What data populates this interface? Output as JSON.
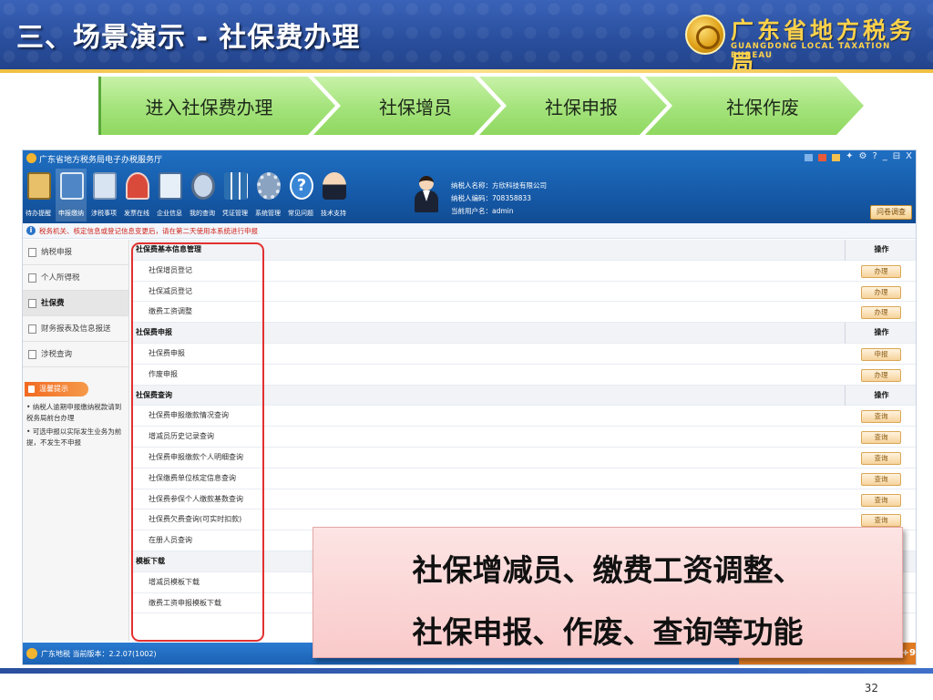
{
  "slide": {
    "title": "三、场景演示 - 社保费办理",
    "bureau_name_cn": "广东省地方税务局",
    "bureau_name_en": "GUANGDONG LOCAL TAXATION BUREAU",
    "page_number": "32"
  },
  "process_steps": [
    "进入社保费办理",
    "社保增员",
    "社保申报",
    "社保作废"
  ],
  "portal": {
    "window_title": "广东省地方税务局电子办税服务厅",
    "window_controls": [
      "?",
      "_",
      "⊟",
      "X"
    ],
    "toolbar": [
      {
        "label": "待办提醒",
        "icon": "clipboard-icon",
        "color": "#e8c06a"
      },
      {
        "label": "申报缴纳",
        "icon": "monitor-icon",
        "color": "#4f86c6"
      },
      {
        "label": "涉税事项",
        "icon": "document-icon",
        "color": "#d9e4f2"
      },
      {
        "label": "发票在线",
        "icon": "stamp-icon",
        "color": "#d94a3a"
      },
      {
        "label": "企业信息",
        "icon": "building-icon",
        "color": "#e6eef8"
      },
      {
        "label": "我的查询",
        "icon": "magnifier-icon",
        "color": "#c8d6ea"
      },
      {
        "label": "凭证管理",
        "icon": "binders-icon",
        "color": "#2c6fb0"
      },
      {
        "label": "系统管理",
        "icon": "gear-icon",
        "color": "#8aa3c0"
      },
      {
        "label": "常见问题",
        "icon": "question-icon",
        "color": "#3a86d6"
      },
      {
        "label": "技术支持",
        "icon": "support-agent-icon",
        "color": "#1b2233"
      }
    ],
    "user": {
      "taxpayer_name": "纳税人名称：方欣科技有限公司",
      "taxpayer_code": "纳税人编码：708358833",
      "current_user": "当前用户名：admin"
    },
    "survey_button": "问卷调查",
    "notice": "税务机关、核定信息或登记信息变更后，请在第二天使用本系统进行申报",
    "sidebar": {
      "items": [
        "纳税申报",
        "个人所得税",
        "社保费",
        "财务报表及信息报送",
        "涉税查询"
      ],
      "tips_title": "温馨提示",
      "tips": [
        "• 纳税人逾期申报缴纳税款请到税务局前台办理",
        "• 可选申报以实际发生业务为前提，不发生不申报"
      ]
    },
    "sections": [
      {
        "title": "社保费基本信息管理",
        "op_header": "操作",
        "items": [
          {
            "label": "社保增员登记",
            "action": "办理"
          },
          {
            "label": "社保减员登记",
            "action": "办理"
          },
          {
            "label": "缴费工资调整",
            "action": "办理"
          }
        ]
      },
      {
        "title": "社保费申报",
        "op_header": "操作",
        "items": [
          {
            "label": "社保费申报",
            "action": "申报"
          },
          {
            "label": "作废申报",
            "action": "办理"
          }
        ]
      },
      {
        "title": "社保费查询",
        "op_header": "操作",
        "items": [
          {
            "label": "社保费申报缴款情况查询",
            "action": "查询"
          },
          {
            "label": "增减员历史记录查询",
            "action": "查询"
          },
          {
            "label": "社保费申报缴款个人明细查询",
            "action": "查询"
          },
          {
            "label": "社保缴费单位核定信息查询",
            "action": "查询"
          },
          {
            "label": "社保费参保个人缴款基数查询",
            "action": "查询"
          },
          {
            "label": "社保费欠费查询(可实时扣款)",
            "action": "查询"
          },
          {
            "label": "在册人员查询",
            "action": ""
          }
        ]
      },
      {
        "title": "模板下载",
        "op_header": "",
        "items": [
          {
            "label": "增减员模板下载",
            "action": ""
          },
          {
            "label": "缴费工资申报模板下载",
            "action": ""
          }
        ]
      }
    ],
    "status": {
      "brand": "广东地税",
      "version": "当前版本：2.2.07(1002)",
      "right": "+9"
    }
  },
  "callout": {
    "line1": "社保增减员、缴费工资调整、",
    "line2": "社保申报、作废、查询等功能"
  },
  "colors": {
    "header_blue": "#2a4f9e",
    "bureau_gold": "#ffd24a",
    "arrow_green": "#a6e47e",
    "highlight_red": "#e23030",
    "callout_pink": "#f9caca"
  }
}
